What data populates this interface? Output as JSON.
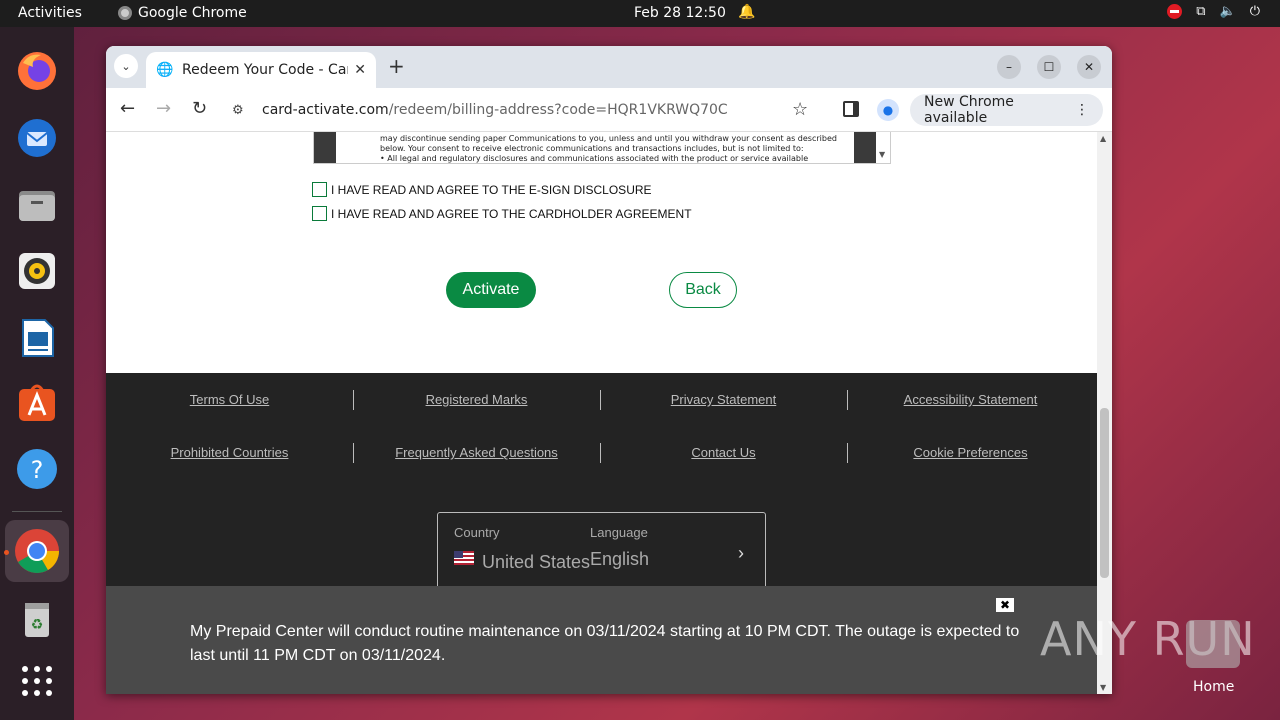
{
  "topbar": {
    "activities": "Activities",
    "app_name": "Google Chrome",
    "clock": "Feb 28  12:50"
  },
  "dock": {
    "items": [
      "firefox-icon",
      "thunderbird-icon",
      "files-icon",
      "rhythmbox-icon",
      "writer-icon",
      "appcenter-icon",
      "help-icon",
      "chrome-icon",
      "trash-icon",
      "apps-grid-icon"
    ]
  },
  "browser": {
    "tab_title": "Redeem Your Code - Card",
    "url_host": "card-activate.com",
    "url_path": "/redeem/billing-address?code=HQR1VKRWQ70C",
    "new_chrome": "New Chrome available"
  },
  "page": {
    "disclosure_text": [
      "may discontinue sending paper Communications to you, unless and until you withdraw your consent as described",
      "below. Your consent to receive electronic communications and transactions includes, but is not limited to:",
      "• All legal and regulatory disclosures and communications associated with the product or service available through"
    ],
    "checkbox1": "I HAVE READ AND AGREE TO THE E-SIGN DISCLOSURE",
    "checkbox2": "I HAVE READ AND AGREE TO THE CARDHOLDER AGREEMENT",
    "activate": "Activate",
    "back": "Back"
  },
  "footer": {
    "row1": [
      "Terms Of Use",
      "Registered Marks",
      "Privacy Statement",
      "Accessibility Statement"
    ],
    "row2": [
      "Prohibited Countries",
      "Frequently Asked Questions",
      "Contact Us",
      "Cookie Preferences"
    ],
    "country_label": "Country",
    "country_value": "United States",
    "language_label": "Language",
    "language_value": "English"
  },
  "banner": {
    "message": "My Prepaid Center will conduct routine maintenance on 03/11/2024 starting at 10 PM CDT. The outage is expected to last until 11 PM CDT on 03/11/2024.",
    "close": "✖"
  },
  "desktop": {
    "watermark": "ANY RUN",
    "home_label": "Home"
  }
}
